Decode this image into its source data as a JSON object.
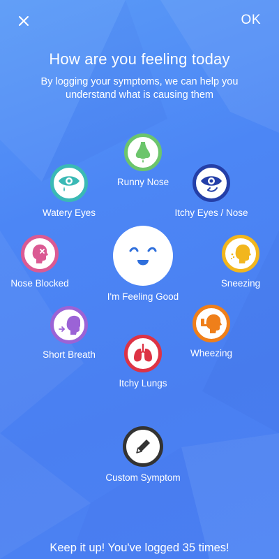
{
  "header": {
    "close_icon": "close-icon",
    "ok_label": "OK"
  },
  "title": "How are you feeling today",
  "subtitle": "By logging your symptoms, we can help you understand what is causing them",
  "symptoms": {
    "runny_nose": {
      "label": "Runny Nose",
      "icon": "nose-drip-icon",
      "color": "#6cc56c"
    },
    "watery_eyes": {
      "label": "Watery Eyes",
      "icon": "eye-tear-icon",
      "color": "#3ab9b5"
    },
    "itchy_eyes": {
      "label": "Itchy Eyes / Nose",
      "icon": "eye-scratch-icon",
      "color": "#243fa8"
    },
    "nose_blocked": {
      "label": "Nose Blocked",
      "icon": "head-blocked-icon",
      "color": "#db5a93"
    },
    "feeling_good": {
      "label": "I'm Feeling Good",
      "icon": "smiley-face-icon",
      "color": "#2f6fdc"
    },
    "sneezing": {
      "label": "Sneezing",
      "icon": "sneeze-head-icon",
      "color": "#f2b61d"
    },
    "short_breath": {
      "label": "Short Breath",
      "icon": "breath-head-icon",
      "color": "#9b63d6"
    },
    "wheezing": {
      "label": "Wheezing",
      "icon": "inhaler-head-icon",
      "color": "#ef7f1a"
    },
    "itchy_lungs": {
      "label": "Itchy Lungs",
      "icon": "lungs-icon",
      "color": "#dd3345"
    },
    "custom": {
      "label": "Custom Symptom",
      "icon": "pencil-icon",
      "color": "#333333"
    }
  },
  "footer": "Keep it up! You've logged 35 times!"
}
